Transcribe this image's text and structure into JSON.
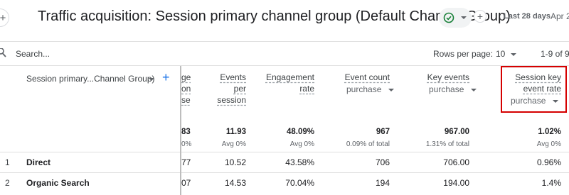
{
  "header": {
    "title": "Traffic acquisition: Session primary channel group (Default Channel Group)",
    "date_label": "Last 28 days",
    "date_range": "Apr 2"
  },
  "toolbar": {
    "search_placeholder": "Search...",
    "rows_per_page_label": "Rows per page:",
    "rows_per_page_value": "10",
    "pagination": "1-9 of 9"
  },
  "table": {
    "dimension_header": "Session primary...Channel Group)",
    "partial_column": {
      "header_lines": [
        "ged",
        "ons",
        "ser"
      ],
      "total": "83",
      "total_sub": "0%",
      "rows": [
        "77",
        "07"
      ]
    },
    "columns": [
      {
        "header_lines": [
          "Events",
          "per",
          "session"
        ],
        "select": "",
        "total": "11.93",
        "total_sub": "Avg 0%"
      },
      {
        "header_lines": [
          "Engagement",
          "rate"
        ],
        "select": "",
        "total": "48.09%",
        "total_sub": "Avg 0%"
      },
      {
        "header_lines": [
          "Event count"
        ],
        "select": "purchase",
        "total": "967",
        "total_sub": "0.09% of total"
      },
      {
        "header_lines": [
          "Key events"
        ],
        "select": "purchase",
        "total": "967.00",
        "total_sub": "1.31% of total"
      },
      {
        "header_lines": [
          "Session key",
          "event rate"
        ],
        "select": "purchase",
        "total": "1.02%",
        "total_sub": "Avg 0%"
      }
    ],
    "rows": [
      {
        "num": "1",
        "name": "Direct",
        "values": [
          "10.52",
          "43.58%",
          "706",
          "706.00",
          "0.96%"
        ]
      },
      {
        "num": "2",
        "name": "Organic Search",
        "values": [
          "14.53",
          "70.04%",
          "194",
          "194.00",
          "1.4%"
        ]
      }
    ]
  },
  "colors": {
    "highlight": "#d50000",
    "accent": "#1a73e8",
    "success": "#188038"
  },
  "icons": [
    "add-icon",
    "check-circle-icon",
    "chevron-down-icon",
    "search-icon",
    "sort-arrow-icon"
  ]
}
